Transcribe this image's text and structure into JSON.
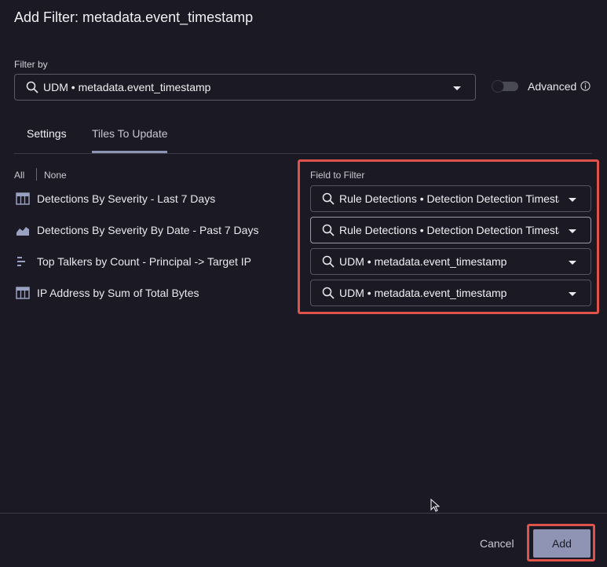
{
  "dialog": {
    "title": "Add Filter: metadata.event_timestamp"
  },
  "filter_by": {
    "label": "Filter by",
    "value": "UDM • metadata.event_timestamp"
  },
  "advanced": {
    "label": "Advanced",
    "enabled": false
  },
  "tabs": [
    {
      "label": "Settings",
      "active": false
    },
    {
      "label": "Tiles To Update",
      "active": true
    }
  ],
  "select": {
    "all": "All",
    "none": "None"
  },
  "field_header": "Field to Filter",
  "tiles": [
    {
      "name": "Detections By Severity - Last 7 Days",
      "icon": "table-icon",
      "field": "Rule Detections • Detection Detection Timestamp"
    },
    {
      "name": "Detections By Severity By Date - Past 7 Days",
      "icon": "area-chart-icon",
      "field": "Rule Detections • Detection Detection Timestamp"
    },
    {
      "name": "Top Talkers by Count - Principal -> Target IP",
      "icon": "bar-list-icon",
      "field": "UDM • metadata.event_timestamp"
    },
    {
      "name": "IP Address by Sum of Total Bytes",
      "icon": "table-icon",
      "field": "UDM • metadata.event_timestamp"
    }
  ],
  "footer": {
    "cancel": "Cancel",
    "add": "Add"
  },
  "colors": {
    "background": "#1b1a24",
    "accent": "#8f94b5",
    "highlight": "#e0534b"
  }
}
